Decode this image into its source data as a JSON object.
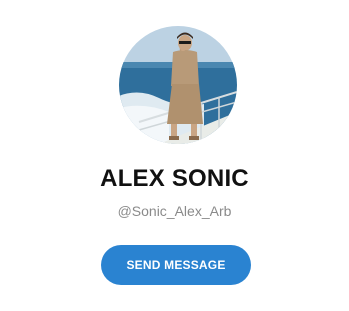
{
  "profile": {
    "name": "ALEX SONIC",
    "handle": "@Sonic_Alex_Arb",
    "send_button_label": "SEND MESSAGE",
    "avatar_description_icon": "avatar-photo-man-on-boat"
  },
  "colors": {
    "button": "#2a83d1",
    "name_text": "#111111",
    "handle_text": "#8a8a8a"
  }
}
